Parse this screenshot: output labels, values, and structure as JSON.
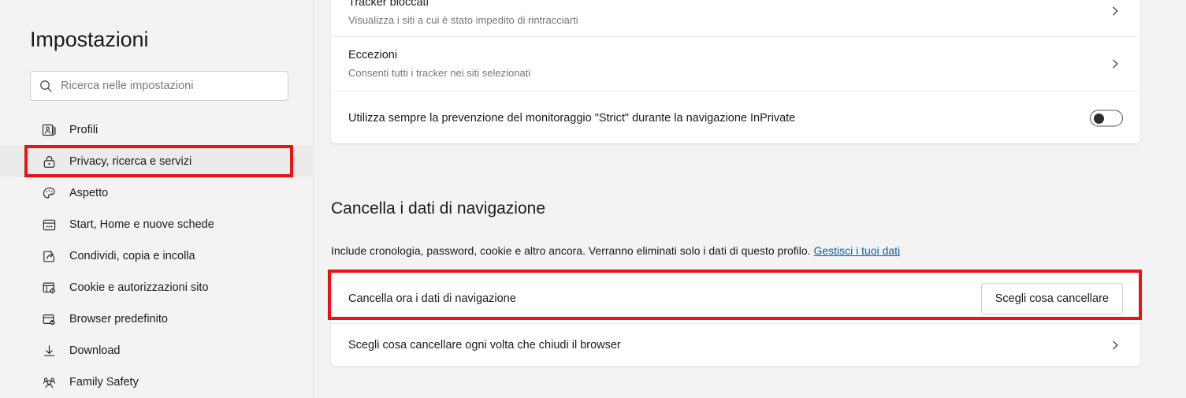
{
  "sidebar": {
    "title": "Impostazioni",
    "search": {
      "placeholder": "Ricerca nelle impostazioni",
      "value": "",
      "icon": "search-icon"
    },
    "items": [
      {
        "label": "Profili",
        "icon": "profile-card-icon",
        "selected": false
      },
      {
        "label": "Privacy, ricerca e servizi",
        "icon": "lock-icon",
        "selected": true
      },
      {
        "label": "Aspetto",
        "icon": "palette-icon",
        "selected": false
      },
      {
        "label": "Start, Home e nuove schede",
        "icon": "new-tab-icon",
        "selected": false
      },
      {
        "label": "Condividi, copia e incolla",
        "icon": "share-icon",
        "selected": false
      },
      {
        "label": "Cookie e autorizzazioni sito",
        "icon": "cookie-gear-icon",
        "selected": false
      },
      {
        "label": "Browser predefinito",
        "icon": "browser-check-icon",
        "selected": false
      },
      {
        "label": "Download",
        "icon": "download-icon",
        "selected": false
      },
      {
        "label": "Family Safety",
        "icon": "family-group-icon",
        "selected": false
      }
    ]
  },
  "main": {
    "tracking_card": {
      "tracker_blocked": {
        "title": "Tracker bloccati",
        "subtitle": "Visualizza i siti a cui è stato impedito di rintracciarti",
        "chevron": "chevron-right-icon"
      },
      "exceptions": {
        "title": "Eccezioni",
        "subtitle": "Consenti tutti i tracker nei siti selezionati",
        "chevron": "chevron-right-icon"
      },
      "inprivate_strict": {
        "title": "Utilizza sempre la prevenzione del monitoraggio \"Strict\" durante la navigazione InPrivate",
        "toggle_state": "off"
      }
    },
    "clear_section": {
      "heading": "Cancella i dati di navigazione",
      "description_before_link": "Include cronologia, password, cookie e altro ancora. Verranno eliminati solo i dati di questo profilo.",
      "description_link": "Gestisci i tuoi dati",
      "clear_now": {
        "title": "Cancella ora i dati di navigazione",
        "button_label": "Scegli cosa cancellare"
      },
      "clear_on_exit": {
        "title": "Scegli cosa cancellare ogni volta che chiudi il browser",
        "chevron": "chevron-right-icon"
      }
    }
  },
  "annotations": {
    "highlight_color": "#ee1111",
    "selected_nav_target": "Privacy, ricerca e servizi",
    "highlighted_row_target": "Cancella ora i dati di navigazione"
  },
  "colors": {
    "page_background": "#f3f3f3",
    "card_background": "#ffffff",
    "text_primary": "#1b1b1b",
    "text_secondary": "#767676",
    "link": "#0063b1",
    "selected_nav_background": "#ebebeb"
  }
}
